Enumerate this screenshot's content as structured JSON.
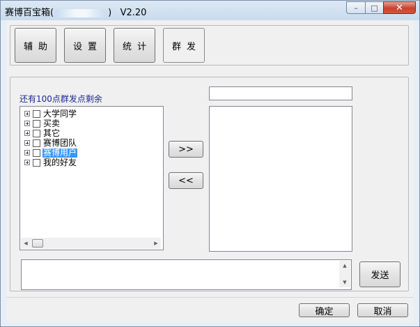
{
  "window": {
    "title_prefix": "赛博百宝箱(",
    "title_suffix": ")",
    "version": "V2.20",
    "controls": {
      "minimize": "–",
      "maximize": "□",
      "close": "✕"
    }
  },
  "tabs": [
    {
      "label": "辅助"
    },
    {
      "label": "设置"
    },
    {
      "label": "统计"
    },
    {
      "label": "群发"
    }
  ],
  "remaining_label": "还有100点群发点剩余",
  "tree": {
    "items": [
      {
        "label": "大学同学",
        "selected": false
      },
      {
        "label": "买卖",
        "selected": false
      },
      {
        "label": "其它",
        "selected": false
      },
      {
        "label": "赛博团队",
        "selected": false
      },
      {
        "label": "赛博用户",
        "selected": true
      },
      {
        "label": "我的好友",
        "selected": false
      }
    ]
  },
  "transfer": {
    "add": ">>",
    "remove": "<<"
  },
  "search_value": "",
  "message_value": "",
  "send_label": "发送",
  "footer": {
    "ok": "确定",
    "cancel": "取消"
  },
  "colors": {
    "selection": "#3399ff",
    "label_text": "#1c2b8f"
  }
}
